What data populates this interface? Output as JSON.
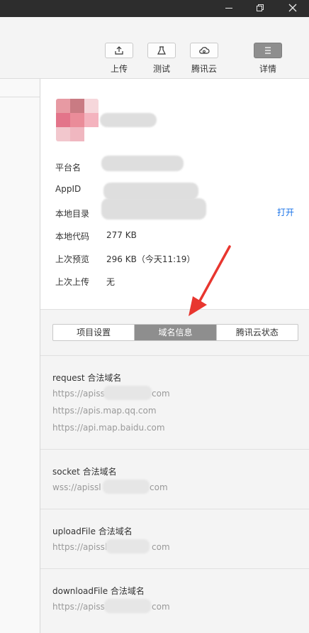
{
  "window_controls": {
    "minimize": "—",
    "maximize": "❐",
    "close": "✕"
  },
  "toolbar": {
    "upload": "上传",
    "test": "测试",
    "cloud": "腾讯云",
    "detail": "详情"
  },
  "info": {
    "platform_label": "平台名",
    "appid_label": "AppID",
    "local_dir_label": "本地目录",
    "open_link": "打开",
    "local_code_label": "本地代码",
    "local_code_value": "277 KB",
    "last_preview_label": "上次预览",
    "last_preview_value": "296 KB（今天11:19）",
    "last_upload_label": "上次上传",
    "last_upload_value": "无"
  },
  "tabs": [
    "项目设置",
    "域名信息",
    "腾讯云状态"
  ],
  "active_tab": "域名信息",
  "domains": {
    "request": {
      "title": "request 合法域名",
      "urls": [
        "https://apissl",
        "https://apis.map.qq.com",
        "https://api.map.baidu.com"
      ],
      "suffix": "com"
    },
    "socket": {
      "title": "socket 合法域名",
      "prefix": "wss://apissl",
      "suffix": "com"
    },
    "upload": {
      "title": "uploadFile 合法域名",
      "prefix": "https://apissl",
      "suffix": "com"
    },
    "download": {
      "title": "downloadFile 合法域名",
      "prefix": "https://apissl",
      "suffix": "com"
    }
  },
  "colors": {
    "accent_link": "#1a73e8",
    "active_tab": "#8e8e8e",
    "arrow": "#e8362f"
  }
}
